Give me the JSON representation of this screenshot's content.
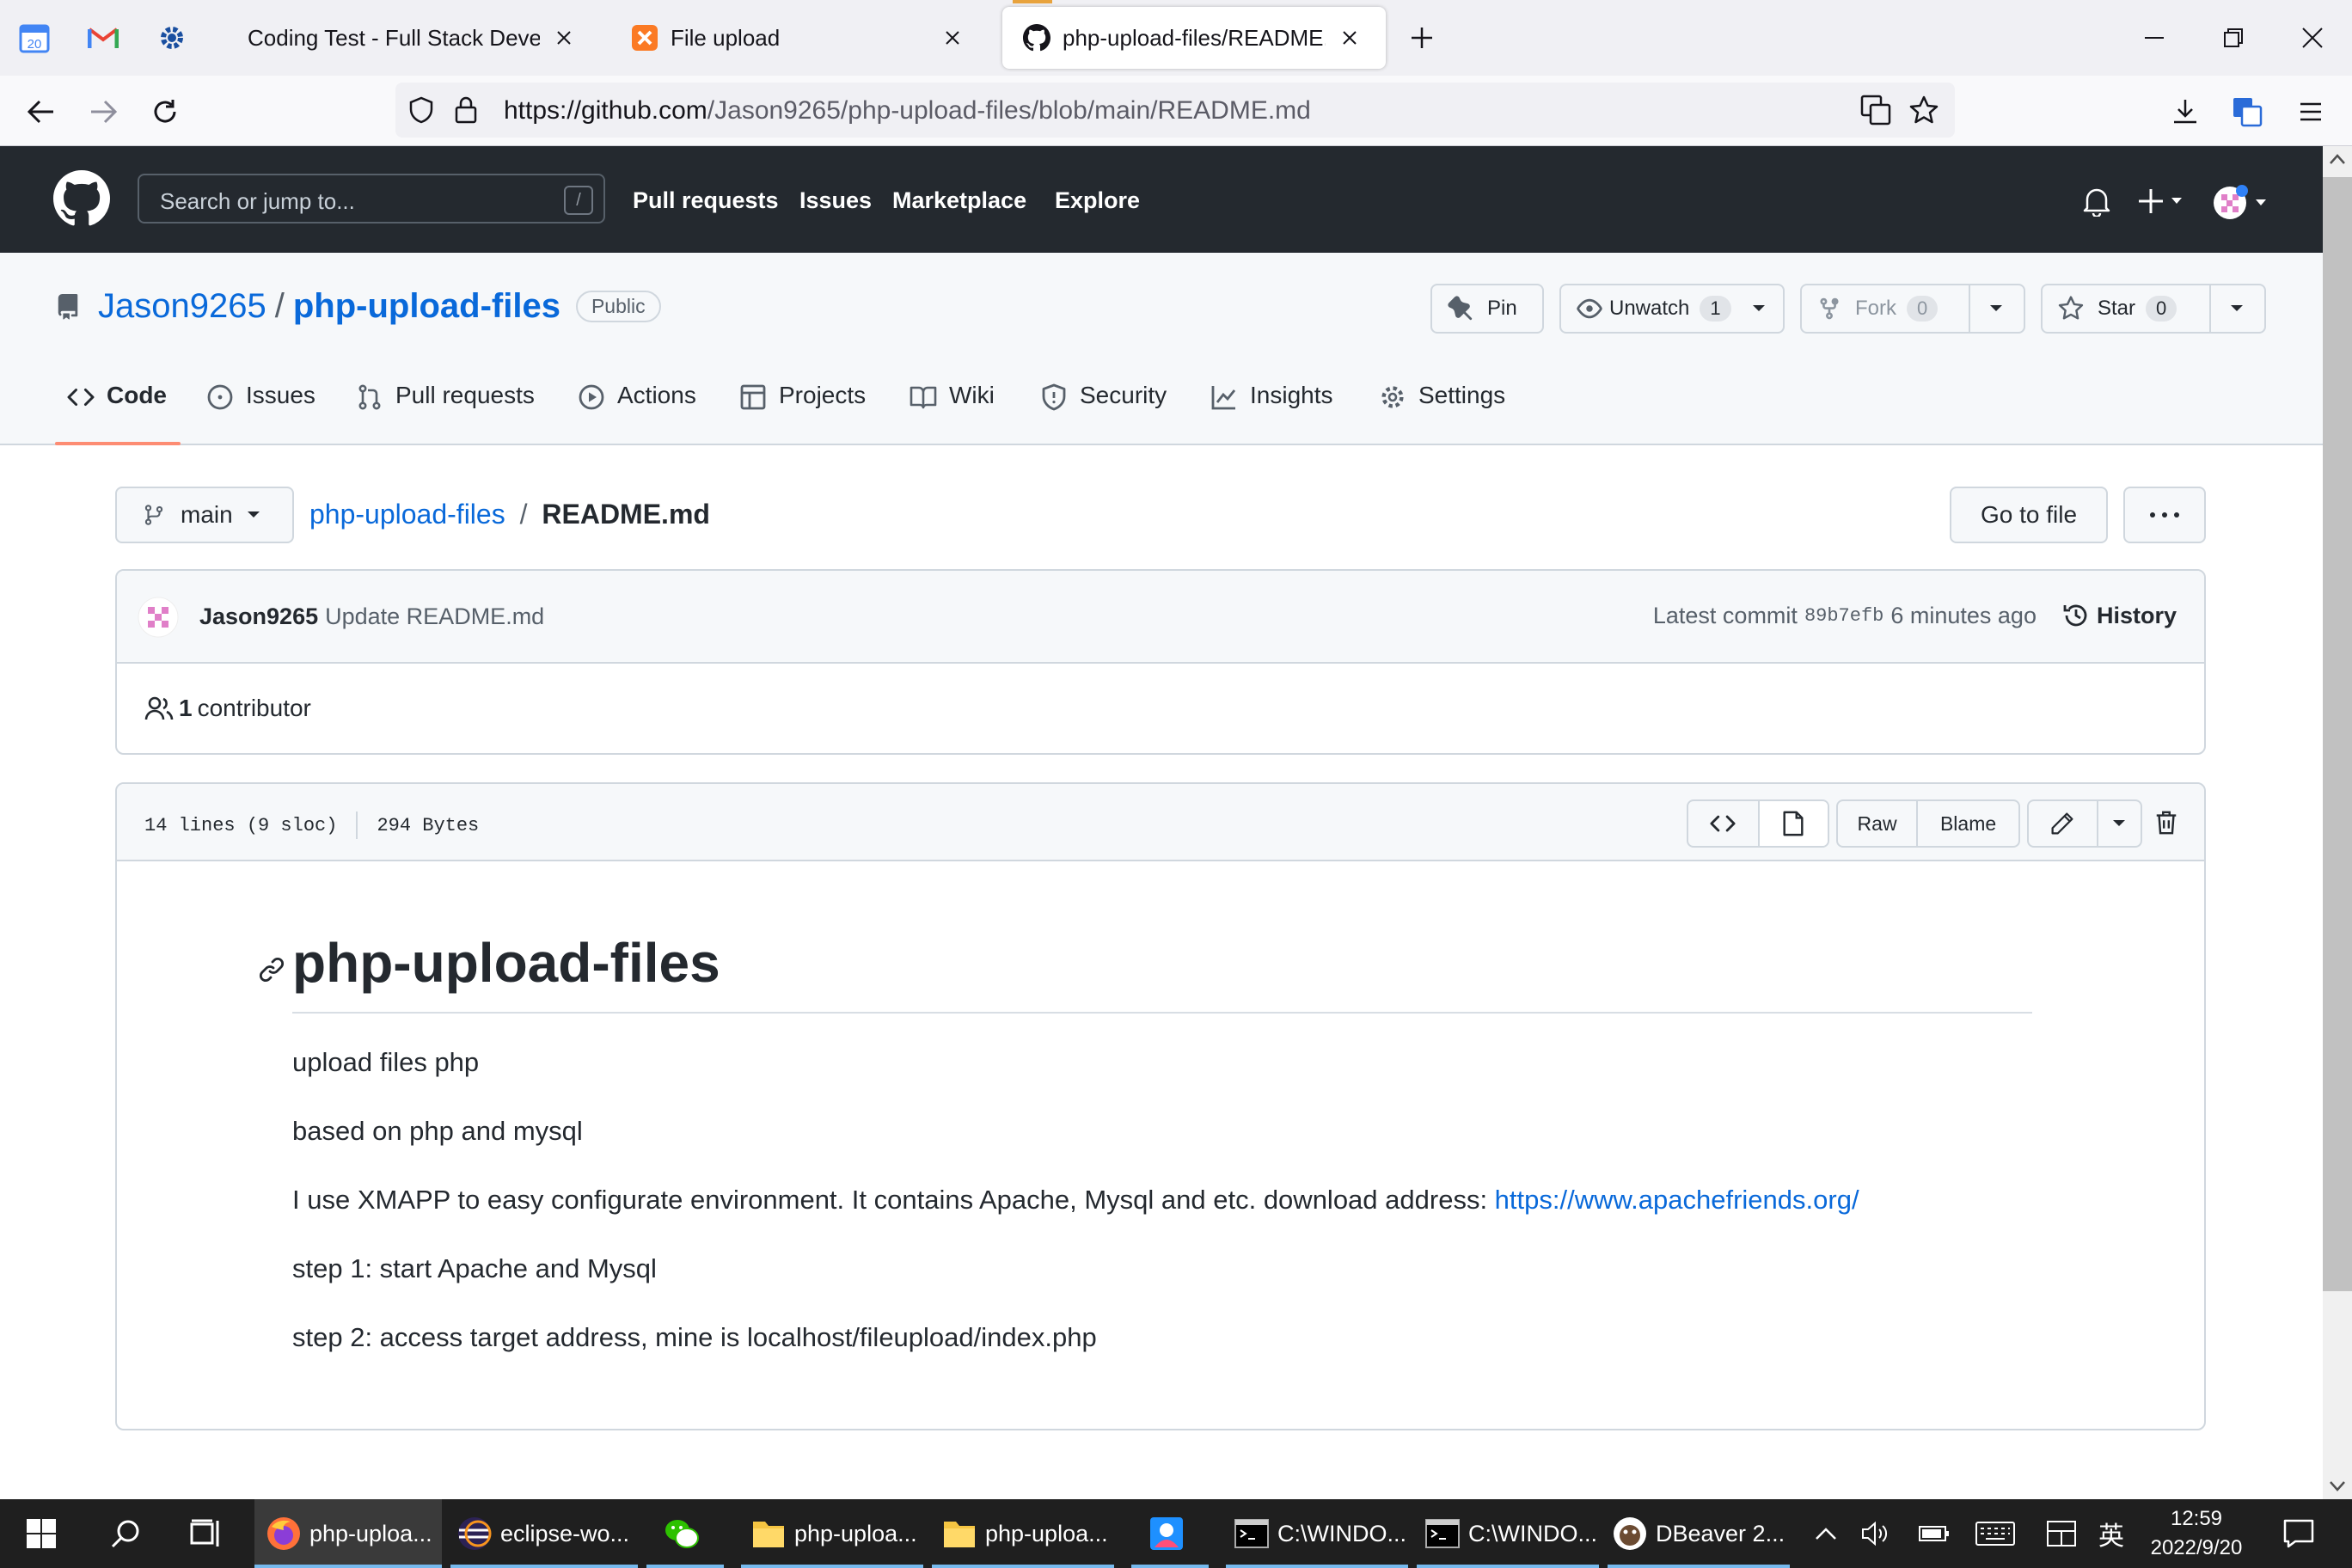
{
  "browser": {
    "tabs": [
      {
        "title": "Coding Test - Full Stack Developer",
        "active": false,
        "icon": "globe-icon"
      },
      {
        "title": "File upload",
        "active": false,
        "icon": "xampp-icon"
      },
      {
        "title": "php-upload-files/README.md",
        "active": true,
        "icon": "github-icon"
      }
    ],
    "url_domain": "https://github.com",
    "url_path": "/Jason9265/php-upload-files/blob/main/README.md"
  },
  "github": {
    "search_placeholder": "Search or jump to...",
    "search_key": "/",
    "nav": [
      "Pull requests",
      "Issues",
      "Marketplace",
      "Explore"
    ]
  },
  "repo": {
    "owner": "Jason9265",
    "separator": "/",
    "name": "php-upload-files",
    "visibility": "Public",
    "pin_label": "Pin",
    "watch_label": "Unwatch",
    "watch_count": "1",
    "fork_label": "Fork",
    "fork_count": "0",
    "star_label": "Star",
    "star_count": "0",
    "tabs": [
      "Code",
      "Issues",
      "Pull requests",
      "Actions",
      "Projects",
      "Wiki",
      "Security",
      "Insights",
      "Settings"
    ]
  },
  "file_nav": {
    "branch": "main",
    "crumb_repo": "php-upload-files",
    "crumb_sep": "/",
    "crumb_file": "README.md",
    "goto_file": "Go to file",
    "more": "···"
  },
  "commit": {
    "author": "Jason9265",
    "message": "Update README.md",
    "latest_label": "Latest commit",
    "sha": "89b7efb",
    "time": "6 minutes ago",
    "history": "History",
    "contributors_count": "1",
    "contributors_label": "contributor"
  },
  "file": {
    "lines": "14 lines (9 sloc)",
    "size": "294 Bytes",
    "raw": "Raw",
    "blame": "Blame"
  },
  "readme": {
    "title": "php-upload-files",
    "p1": "upload files php",
    "p2": "based on php and mysql",
    "p3": "I use XMAPP to easy configurate environment. It contains Apache, Mysql and etc. download address: ",
    "p3_link": "https://www.apachefriends.org/",
    "p4": "step 1: start Apache and Mysql",
    "p5": "step 2: access target address, mine is localhost/fileupload/index.php"
  },
  "taskbar": {
    "apps": [
      {
        "label": "php-uploa...",
        "icon": "firefox-icon"
      },
      {
        "label": "eclipse-wo...",
        "icon": "eclipse-icon"
      },
      {
        "label": "",
        "icon": "wechat-icon"
      },
      {
        "label": "php-uploa...",
        "icon": "folder-icon"
      },
      {
        "label": "php-uploa...",
        "icon": "folder-icon"
      },
      {
        "label": "",
        "icon": "photos-icon"
      },
      {
        "label": "C:\\WINDO...",
        "icon": "cmd-icon"
      },
      {
        "label": "C:\\WINDO...",
        "icon": "cmd-icon"
      },
      {
        "label": "DBeaver 2...",
        "icon": "dbeaver-icon"
      }
    ],
    "ime": "英",
    "time": "12:59",
    "date": "2022/9/20"
  },
  "colors": {
    "link": "#0969da",
    "gh_header": "#24292f",
    "tab_underline": "#fd8c73",
    "taskbar": "#1f1f1f"
  }
}
